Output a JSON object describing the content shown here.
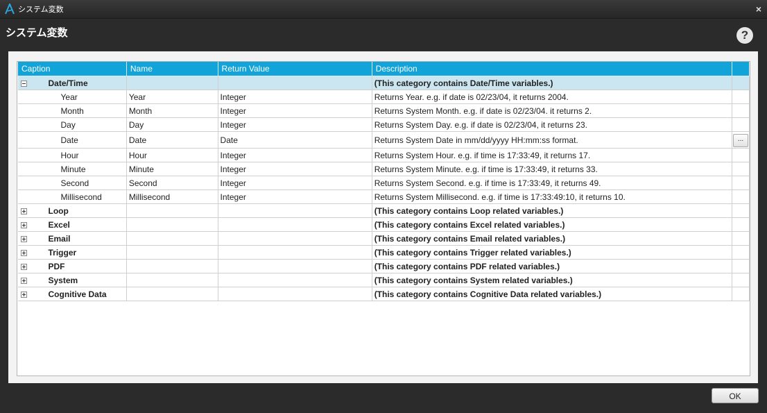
{
  "window": {
    "title": "システム変数",
    "close_glyph": "×"
  },
  "header": {
    "title": "システム変数",
    "help_glyph": "?"
  },
  "grid": {
    "columns": [
      "Caption",
      "Name",
      "Return Value",
      "Description"
    ],
    "rows": [
      {
        "type": "category",
        "expanded": true,
        "caption": "Date/Time",
        "name": "",
        "return_value": "",
        "description": "(This category contains Date/Time variables.)"
      },
      {
        "type": "item",
        "caption": "Year",
        "name": "Year",
        "return_value": "Integer",
        "description": "Returns Year. e.g. if date is 02/23/04, it returns 2004."
      },
      {
        "type": "item",
        "caption": "Month",
        "name": "Month",
        "return_value": "Integer",
        "description": "Returns System Month. e.g. if date is 02/23/04. it returns 2."
      },
      {
        "type": "item",
        "caption": "Day",
        "name": "Day",
        "return_value": "Integer",
        "description": "Returns System Day. e.g. if date is 02/23/04, it returns 23."
      },
      {
        "type": "item",
        "caption": "Date",
        "name": "Date",
        "return_value": "Date",
        "description": "Returns System Date in mm/dd/yyyy HH:mm:ss format.",
        "action": "..."
      },
      {
        "type": "item",
        "caption": "Hour",
        "name": "Hour",
        "return_value": "Integer",
        "description": "Returns System Hour. e.g. if time is 17:33:49, it returns 17."
      },
      {
        "type": "item",
        "caption": "Minute",
        "name": "Minute",
        "return_value": "Integer",
        "description": "Returns System Minute. e.g. if time is 17:33:49, it returns 33."
      },
      {
        "type": "item",
        "caption": "Second",
        "name": "Second",
        "return_value": "Integer",
        "description": "Returns System Second. e.g. if time is 17:33:49, it returns 49."
      },
      {
        "type": "item",
        "caption": "Millisecond",
        "name": "Millisecond",
        "return_value": "Integer",
        "description": "Returns System Millisecond. e.g. if time is 17:33:49:10, it returns 10."
      },
      {
        "type": "category",
        "expanded": false,
        "caption": "Loop",
        "name": "",
        "return_value": "",
        "description": "(This category contains Loop related variables.)"
      },
      {
        "type": "category",
        "expanded": false,
        "caption": "Excel",
        "name": "",
        "return_value": "",
        "description": "(This category contains Excel related variables.)"
      },
      {
        "type": "category",
        "expanded": false,
        "caption": "Email",
        "name": "",
        "return_value": "",
        "description": "(This category contains Email related variables.)"
      },
      {
        "type": "category",
        "expanded": false,
        "caption": "Trigger",
        "name": "",
        "return_value": "",
        "description": "(This category contains Trigger related variables.)"
      },
      {
        "type": "category",
        "expanded": false,
        "caption": "PDF",
        "name": "",
        "return_value": "",
        "description": "(This category contains PDF related variables.)"
      },
      {
        "type": "category",
        "expanded": false,
        "caption": "System",
        "name": "",
        "return_value": "",
        "description": "(This category contains System related variables.)"
      },
      {
        "type": "category",
        "expanded": false,
        "caption": "Cognitive Data",
        "name": "",
        "return_value": "",
        "description": "(This category contains Cognitive Data related variables.)"
      }
    ]
  },
  "footer": {
    "ok_label": "OK"
  },
  "colors": {
    "header_bg": "#12a3d9",
    "selected_row": "#cbe6f1",
    "window_bg": "#2b2b2b"
  }
}
